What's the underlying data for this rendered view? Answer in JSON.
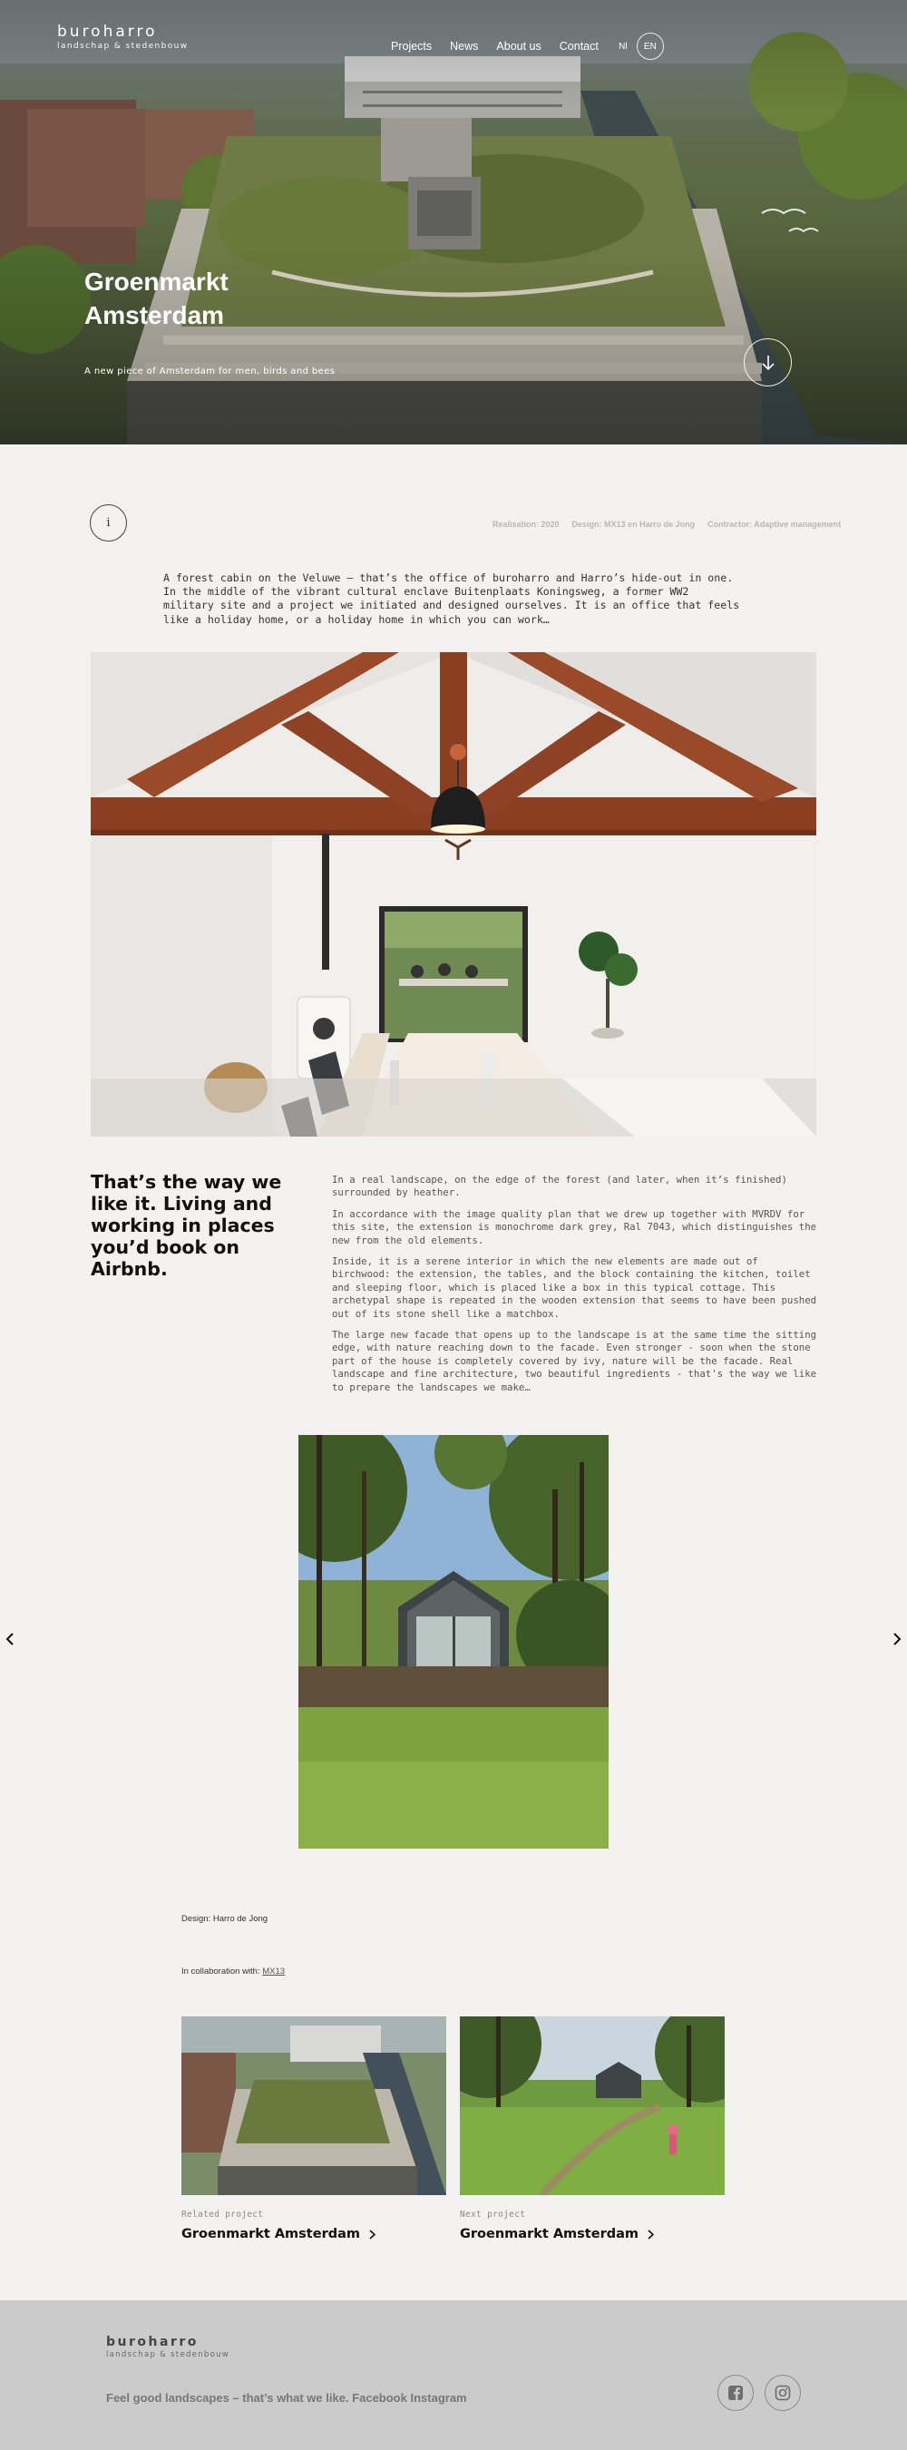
{
  "brand": {
    "name": "buroharro",
    "tagline": "landschap & stedenbouw"
  },
  "nav": {
    "items": [
      "Projects",
      "News",
      "About us",
      "Contact"
    ],
    "languages": [
      "Nl",
      "EN"
    ],
    "active_language": "EN"
  },
  "hero": {
    "title_line1": "Groenmarkt",
    "title_line2": "Amsterdam",
    "subtitle": "A new piece of Amsterdam for men, birds and bees"
  },
  "info": {
    "button_label": "i",
    "meta": [
      "Realisation: 2020",
      "Design: MX13 en Harro de Jong",
      "Contractor: Adaptive management"
    ]
  },
  "intro_text": "A forest cabin on the Veluwe – that’s the office of buroharro and Harro’s hide-out in one. In the middle of the vibrant cultural enclave Buitenplaats Koningsweg, a former WW2 military site and a project we initiated and designed ourselves. It is an office that feels like a holiday home, or a holiday home in which you can work…",
  "quote": "That’s the way we like it. Living and working in places you’d book on Airbnb.",
  "paragraphs": [
    "In a real landscape, on the edge of the forest (and later, when it’s finished) surrounded by heather.",
    "In accordance with the image quality plan that we drew up together with MVRDV for this site, the extension is monochrome dark grey, Ral 7043, which distinguishes the new from the old elements.",
    "Inside, it is a serene interior in which the new elements are made out of birchwood: the extension, the tables, and the block containing the kitchen, toilet and sleeping floor, which is placed like a box in this typical cottage. This archetypal shape is repeated in the wooden extension that seems to have been pushed out of its stone shell like a matchbox.",
    "The large new facade that opens up to the landscape is at the same time the sitting edge, with nature reaching down to the facade. Even stronger - soon when the stone part of the house is completely covered by ivy, nature will be the facade. Real landscape and fine architecture, two beautiful ingredients - that's the way we like to prepare the landscapes we make…"
  ],
  "credits": {
    "design": "Design: Harro de Jong",
    "collab_label": "In collaboration with:",
    "collab_link": "MX13"
  },
  "related": [
    {
      "tag": "Related project",
      "title": "Groenmarkt Amsterdam"
    },
    {
      "tag": "Next project",
      "title": "Groenmarkt Amsterdam"
    }
  ],
  "footer": {
    "tagline": "Feel good landscapes – that’s what we like.",
    "links": [
      "Facebook",
      "Instagram"
    ]
  },
  "colors": {
    "background": "#f3f2f0",
    "footer": "#cbcbcb",
    "wood": "#8a3f22"
  }
}
